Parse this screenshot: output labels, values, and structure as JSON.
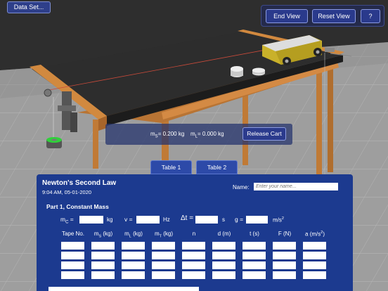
{
  "toolbar": {
    "dataset_label": "Data Set...",
    "end_view_label": "End View",
    "reset_view_label": "Reset View",
    "help_label": "?"
  },
  "release": {
    "ms_label": "m",
    "ms_sub": "S",
    "ms_value": "= 0.200 kg",
    "ml_label": "m",
    "ml_sub": "L",
    "ml_value": "= 0.000 kg",
    "button_label": "Release Cart"
  },
  "tabs": [
    {
      "label": "Table 1",
      "active": true
    },
    {
      "label": "Table 2",
      "active": false
    }
  ],
  "sheet": {
    "title": "Newton's Second Law",
    "timestamp": "9:04 AM, 05-01-2020",
    "name_label": "Name:",
    "name_placeholder": "Enter your name...",
    "part_title": "Part 1, Constant Mass",
    "params": {
      "mc_label": "m",
      "mc_sub": "C",
      "mc_eq": " =",
      "mc_unit": "kg",
      "v_label": "v =",
      "v_unit": "Hz",
      "dt_label": "Δt =",
      "dt_unit": "s",
      "g_label": "g =",
      "g_unit": "m/s",
      "g_unit_sup": "2"
    },
    "columns": [
      {
        "main": "Tape No.",
        "sub": "",
        "tail": ""
      },
      {
        "main": "m",
        "sub": "S",
        "tail": " (kg)"
      },
      {
        "main": "m",
        "sub": "L",
        "tail": " (kg)"
      },
      {
        "main": "m",
        "sub": "T",
        "tail": " (kg)"
      },
      {
        "main": "n",
        "sub": "",
        "tail": ""
      },
      {
        "main": "d (m)",
        "sub": "",
        "tail": ""
      },
      {
        "main": "t (s)",
        "sub": "",
        "tail": ""
      },
      {
        "main": "F (N)",
        "sub": "",
        "tail": ""
      },
      {
        "main": "a (m/s",
        "sub": "",
        "tail": ")",
        "sup": "2"
      }
    ],
    "row_count": 4
  },
  "colors": {
    "sheet_bg": "#1c3a8f",
    "button_bg": "#2a3a8c",
    "tab_bg": "#2d4aa8",
    "cart_body": "#c9b12a",
    "table_top": "#2b2b2b",
    "table_wood": "#c4823e",
    "floor": "#9a9a9a",
    "weight_green": "#2fd13a"
  }
}
